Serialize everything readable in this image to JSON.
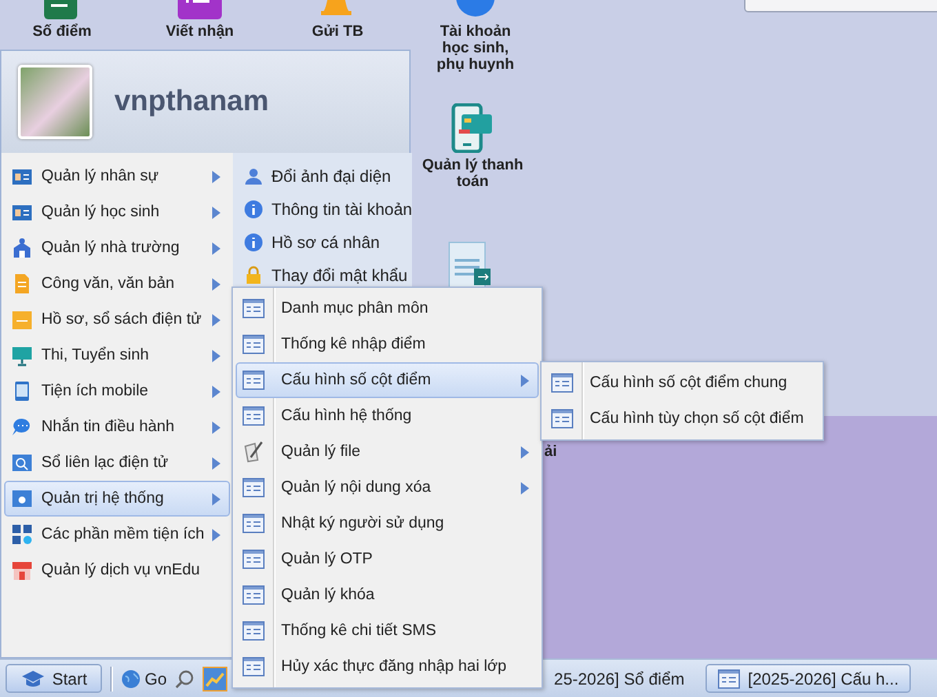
{
  "desktop_icons": [
    {
      "label": "Số điểm"
    },
    {
      "label": "Viết nhận"
    },
    {
      "label": "Gửi TB"
    },
    {
      "label": "Tài khoản học sinh, phụ huynh"
    },
    {
      "label": "Quản lý thanh toán"
    },
    {
      "label": "ải"
    }
  ],
  "start_menu": {
    "username": "vnpthanam",
    "items": [
      {
        "label": "Quản lý nhân sự",
        "submenu": true,
        "selected": false
      },
      {
        "label": "Quản lý học sinh",
        "submenu": true,
        "selected": false
      },
      {
        "label": "Quản lý nhà trường",
        "submenu": true,
        "selected": false
      },
      {
        "label": "Công văn, văn bản",
        "submenu": true,
        "selected": false
      },
      {
        "label": "Hồ sơ, sổ sách điện tử",
        "submenu": true,
        "selected": false
      },
      {
        "label": "Thi, Tuyển sinh",
        "submenu": true,
        "selected": false
      },
      {
        "label": "Tiện ích mobile",
        "submenu": true,
        "selected": false
      },
      {
        "label": "Nhắn tin điều hành",
        "submenu": true,
        "selected": false
      },
      {
        "label": "Sổ liên lạc điện tử",
        "submenu": true,
        "selected": false
      },
      {
        "label": "Quản trị hệ thống",
        "submenu": true,
        "selected": true
      },
      {
        "label": "Các phần mềm tiện ích",
        "submenu": true,
        "selected": false
      },
      {
        "label": "Quản lý dịch vụ vnEdu",
        "submenu": false,
        "selected": false
      }
    ],
    "account_items": [
      {
        "label": "Đổi ảnh đại diện"
      },
      {
        "label": "Thông tin tài khoản"
      },
      {
        "label": "Hồ sơ cá nhân"
      },
      {
        "label": "Thay đổi mật khẩu"
      }
    ]
  },
  "submenu": {
    "items": [
      {
        "label": "Danh mục phân môn",
        "submenu": false,
        "selected": false
      },
      {
        "label": "Thống kê nhập điểm",
        "submenu": false,
        "selected": false
      },
      {
        "label": "Cấu hình số cột điểm",
        "submenu": true,
        "selected": true
      },
      {
        "label": "Cấu hình hệ thống",
        "submenu": false,
        "selected": false
      },
      {
        "label": "Quản lý file",
        "submenu": true,
        "selected": false
      },
      {
        "label": "Quản lý nội dung xóa",
        "submenu": true,
        "selected": false
      },
      {
        "label": "Nhật ký người sử dụng",
        "submenu": false,
        "selected": false
      },
      {
        "label": "Quản lý OTP",
        "submenu": false,
        "selected": false
      },
      {
        "label": "Quản lý khóa",
        "submenu": false,
        "selected": false
      },
      {
        "label": "Thống kê chi tiết SMS",
        "submenu": false,
        "selected": false
      },
      {
        "label": "Hủy xác thực đăng nhập hai lớp",
        "submenu": false,
        "selected": false
      }
    ]
  },
  "submenu_2": {
    "items": [
      {
        "label": "Cấu hình số cột điểm chung",
        "selected": false
      },
      {
        "label": "Cấu hình tùy chọn số cột điểm",
        "selected": false
      }
    ]
  },
  "taskbar": {
    "start": "Start",
    "go": "Go",
    "windows": [
      {
        "label": "25-2026] Sổ điểm",
        "selected": false
      },
      {
        "label": "[2025-2026] Cấu h...",
        "selected": true
      }
    ]
  }
}
